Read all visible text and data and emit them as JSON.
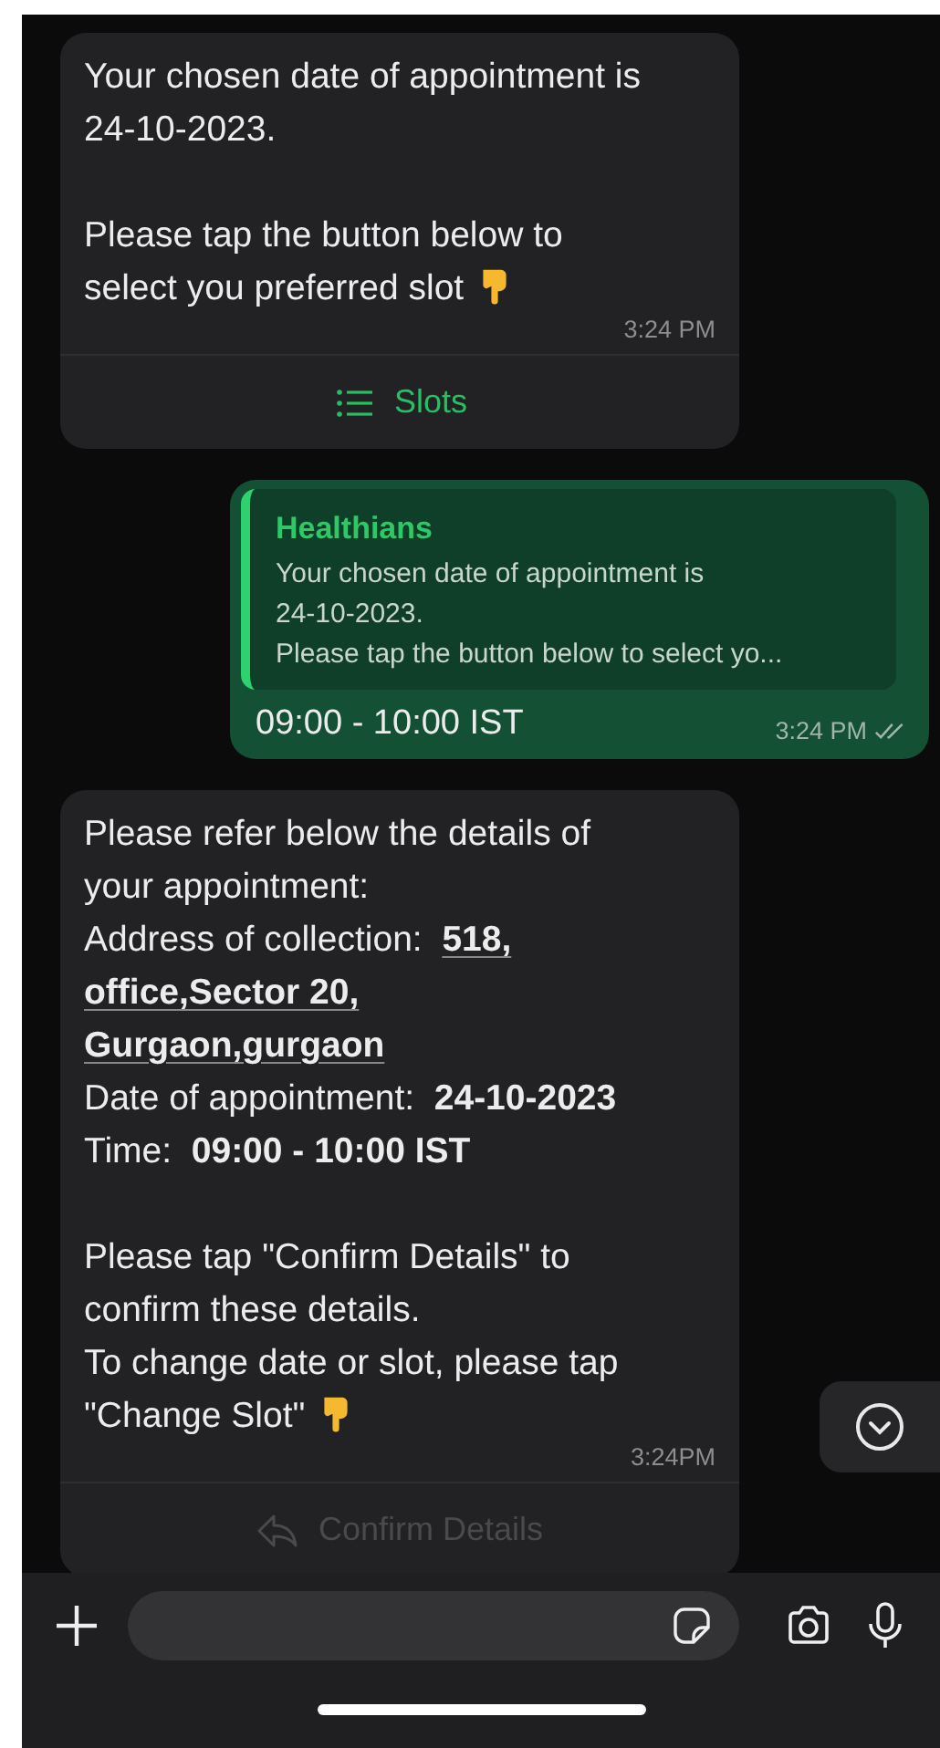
{
  "messages": [
    {
      "kind": "incoming",
      "paragraphs": [
        {
          "kind": "text",
          "text": "Your chosen date of appointment is 24-10-2023."
        },
        {
          "kind": "gap"
        },
        {
          "kind": "text",
          "text": "Please tap the button below to"
        },
        {
          "kind": "text",
          "text": "select you preferred slot"
        }
      ],
      "time": "3:24 PM",
      "button": {
        "label": "Slots",
        "disabled": false
      }
    },
    {
      "kind": "outgoing",
      "quote": {
        "author": "Healthians",
        "lines": [
          "Your chosen date of appointment is",
          "24-10-2023.",
          "Please tap the button below to select yo..."
        ]
      },
      "text": "09:00 - 10:00 IST",
      "time": "3:24 PM"
    },
    {
      "kind": "incoming",
      "paragraphs": [
        {
          "kind": "text",
          "text": "Please refer below the details of your appointment:"
        },
        {
          "kind": "detail",
          "label": "Address of collection:",
          "value": "518, office,Sector 20, Gurgaon,gurgaon",
          "underlined": true
        },
        {
          "kind": "detail",
          "label": "Date of appointment:",
          "value": "24-10-2023",
          "underlined": false
        },
        {
          "kind": "detail",
          "label": "Time:",
          "value": "09:00 - 10:00 IST",
          "underlined": false
        },
        {
          "kind": "gap"
        },
        {
          "kind": "text",
          "text": "Please tap \"Confirm Details\" to confirm these details."
        },
        {
          "kind": "text",
          "text": "To change date or slot, please tap"
        },
        {
          "kind": "text",
          "text": "\"Change Slot\""
        }
      ],
      "time": "3:24PM",
      "button": {
        "label": "Confirm Details",
        "disabled": true
      }
    }
  ]
}
